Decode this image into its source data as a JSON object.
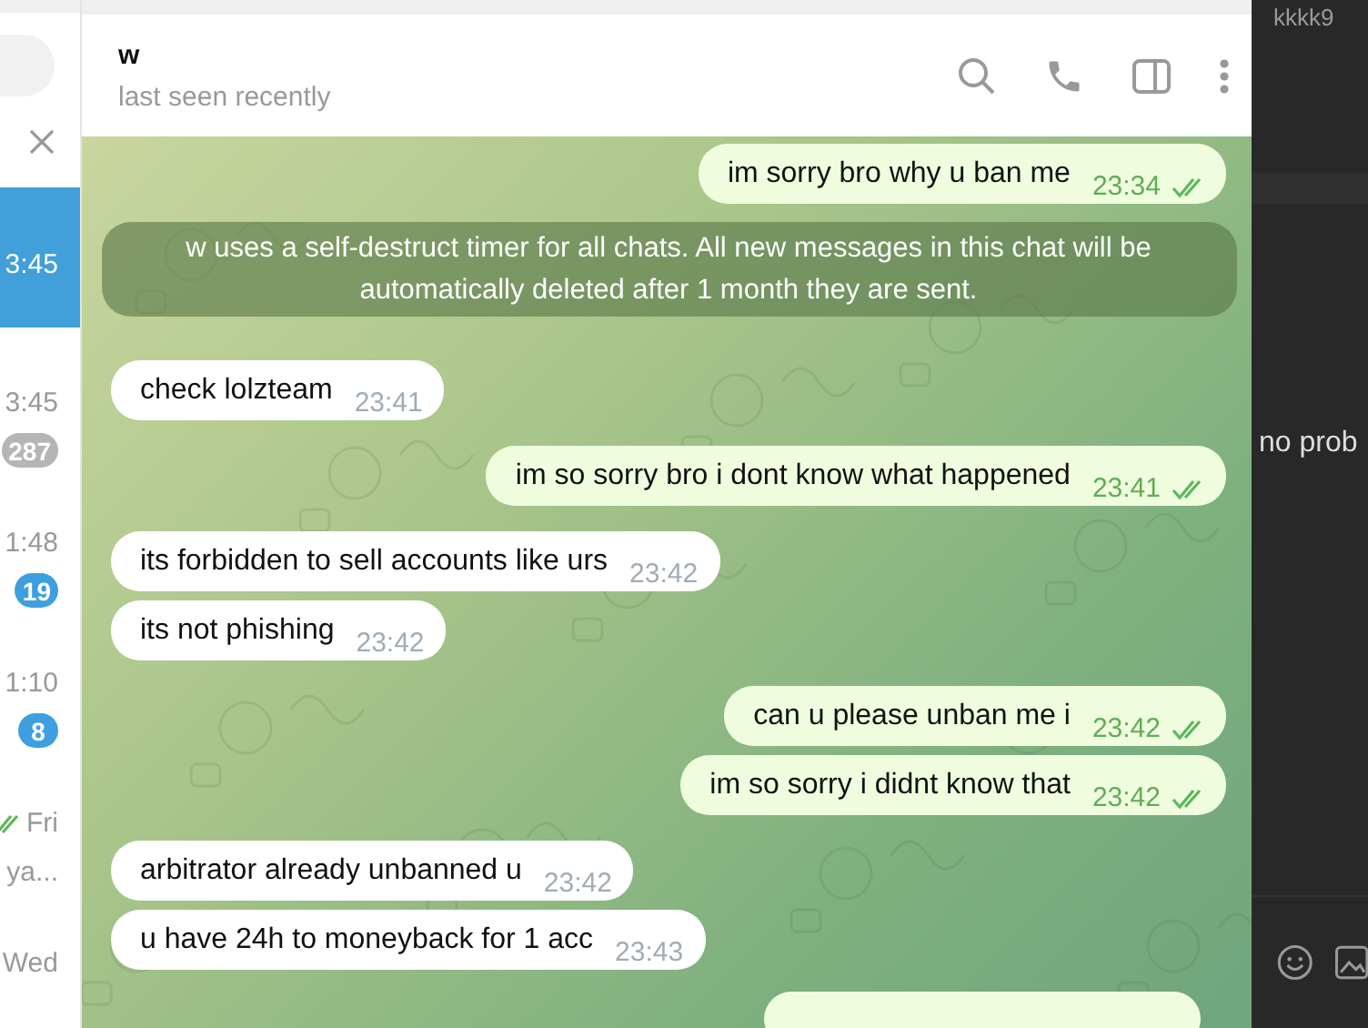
{
  "chat_list": {
    "rows": [
      {
        "time": "3:45",
        "selected": true
      },
      {
        "time": "3:45",
        "badge": "287",
        "muted": true,
        "selected": false
      },
      {
        "time": "1:48",
        "badge": "19",
        "muted": false,
        "selected": false
      },
      {
        "time": "1:10",
        "badge": "8",
        "muted": false,
        "selected": false
      },
      {
        "time": "Fri",
        "read": true,
        "preview": "ya...",
        "selected": false
      },
      {
        "time": "Wed",
        "selected": false
      }
    ]
  },
  "header": {
    "name": "w",
    "status": "last seen recently"
  },
  "messages": [
    {
      "kind": "out",
      "text": "im sorry bro why u ban me",
      "time": "23:34",
      "read": true
    },
    {
      "kind": "service",
      "text": "w uses a self-destruct timer for all chats. All new messages in this chat will be automatically deleted after 1 month they are sent."
    },
    {
      "kind": "in",
      "text": "check lolzteam",
      "time": "23:41"
    },
    {
      "kind": "out",
      "text": "im so sorry bro i dont know what happened",
      "time": "23:41",
      "read": true
    },
    {
      "kind": "in",
      "text": "its forbidden to sell accounts like urs",
      "time": "23:42"
    },
    {
      "kind": "in",
      "text": "its not phishing",
      "time": "23:42"
    },
    {
      "kind": "out",
      "text": "can u please unban me i",
      "time": "23:42",
      "read": true
    },
    {
      "kind": "out",
      "text": "im so sorry i didnt know that",
      "time": "23:42",
      "read": true
    },
    {
      "kind": "in",
      "text": "arbitrator already unbanned u",
      "time": "23:42"
    },
    {
      "kind": "in",
      "text": "u have 24h to moneyback for 1 acc",
      "time": "23:43"
    }
  ],
  "side_panel": {
    "top_text": "kkkk9",
    "message": "no prob"
  }
}
